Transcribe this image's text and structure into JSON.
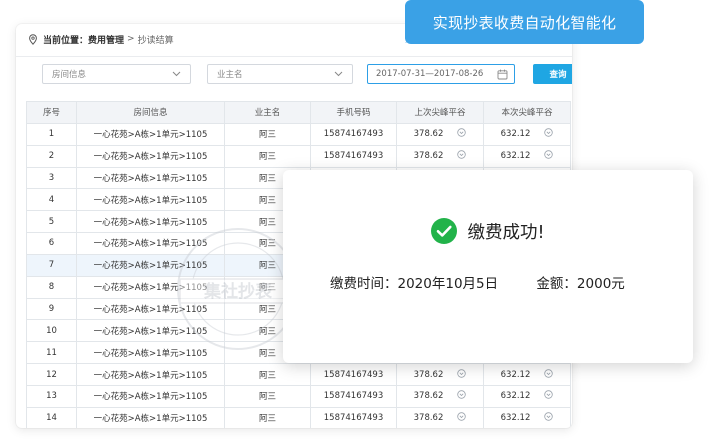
{
  "breadcrumb": {
    "current_label": "当前位置：",
    "level1": "费用管理",
    "separator": ">",
    "level2": "抄读结算"
  },
  "filters": {
    "room_placeholder": "房间信息",
    "owner_placeholder": "业主名",
    "date_range": "2017-07-31—2017-08-26",
    "query_label": "查询"
  },
  "table": {
    "headers": [
      "序号",
      "房间信息",
      "业主名",
      "手机号码",
      "上次尖峰平谷",
      "本次尖峰平谷"
    ],
    "rows": [
      {
        "no": "1",
        "room": "一心花苑>A栋>1单元>1105",
        "owner": "阿三",
        "phone": "15874167493",
        "last": "378.62",
        "current": "632.12"
      },
      {
        "no": "2",
        "room": "一心花苑>A栋>1单元>1105",
        "owner": "阿三",
        "phone": "15874167493",
        "last": "378.62",
        "current": "632.12"
      },
      {
        "no": "3",
        "room": "一心花苑>A栋>1单元>1105",
        "owner": "阿三",
        "phone": "",
        "last": "",
        "current": ""
      },
      {
        "no": "4",
        "room": "一心花苑>A栋>1单元>1105",
        "owner": "阿三",
        "phone": "",
        "last": "",
        "current": ""
      },
      {
        "no": "5",
        "room": "一心花苑>A栋>1单元>1105",
        "owner": "阿三",
        "phone": "",
        "last": "",
        "current": ""
      },
      {
        "no": "6",
        "room": "一心花苑>A栋>1单元>1105",
        "owner": "阿三",
        "phone": "",
        "last": "",
        "current": ""
      },
      {
        "no": "7",
        "room": "一心花苑>A栋>1单元>1105",
        "owner": "阿三",
        "phone": "",
        "last": "",
        "current": ""
      },
      {
        "no": "8",
        "room": "一心花苑>A栋>1单元>1105",
        "owner": "阿三",
        "phone": "",
        "last": "",
        "current": ""
      },
      {
        "no": "9",
        "room": "一心花苑>A栋>1单元>1105",
        "owner": "阿三",
        "phone": "",
        "last": "",
        "current": ""
      },
      {
        "no": "10",
        "room": "一心花苑>A栋>1单元>1105",
        "owner": "阿三",
        "phone": "",
        "last": "",
        "current": ""
      },
      {
        "no": "11",
        "room": "一心花苑>A栋>1单元>1105",
        "owner": "阿三",
        "phone": "",
        "last": "",
        "current": ""
      },
      {
        "no": "12",
        "room": "一心花苑>A栋>1单元>1105",
        "owner": "阿三",
        "phone": "15874167493",
        "last": "378.62",
        "current": "632.12"
      },
      {
        "no": "13",
        "room": "一心花苑>A栋>1单元>1105",
        "owner": "阿三",
        "phone": "15874167493",
        "last": "378.62",
        "current": "632.12"
      },
      {
        "no": "14",
        "room": "一心花苑>A栋>1单元>1105",
        "owner": "阿三",
        "phone": "15874167493",
        "last": "378.62",
        "current": "632.12"
      }
    ],
    "highlighted_row": "7"
  },
  "callout": {
    "text": "实现抄表收费自动化智能化"
  },
  "dialog": {
    "title": "缴费成功!",
    "time_label": "缴费时间：",
    "time_value": "2020年10月5日",
    "amount_label": "金额：",
    "amount_value": "2000元"
  },
  "watermark": {
    "text": "集社抄表"
  },
  "colors": {
    "accent": "#1fa6e3",
    "callout": "#3aa1e6",
    "success": "#22b34a",
    "row_highlight": "#eef5fc",
    "header_bg": "#f2f4f7"
  },
  "icons": {
    "breadcrumb": "location-pin-icon",
    "select": "chevron-down-icon",
    "date": "calendar-icon",
    "row_action": "circle-chevron-icon",
    "success": "check-circle-icon"
  }
}
